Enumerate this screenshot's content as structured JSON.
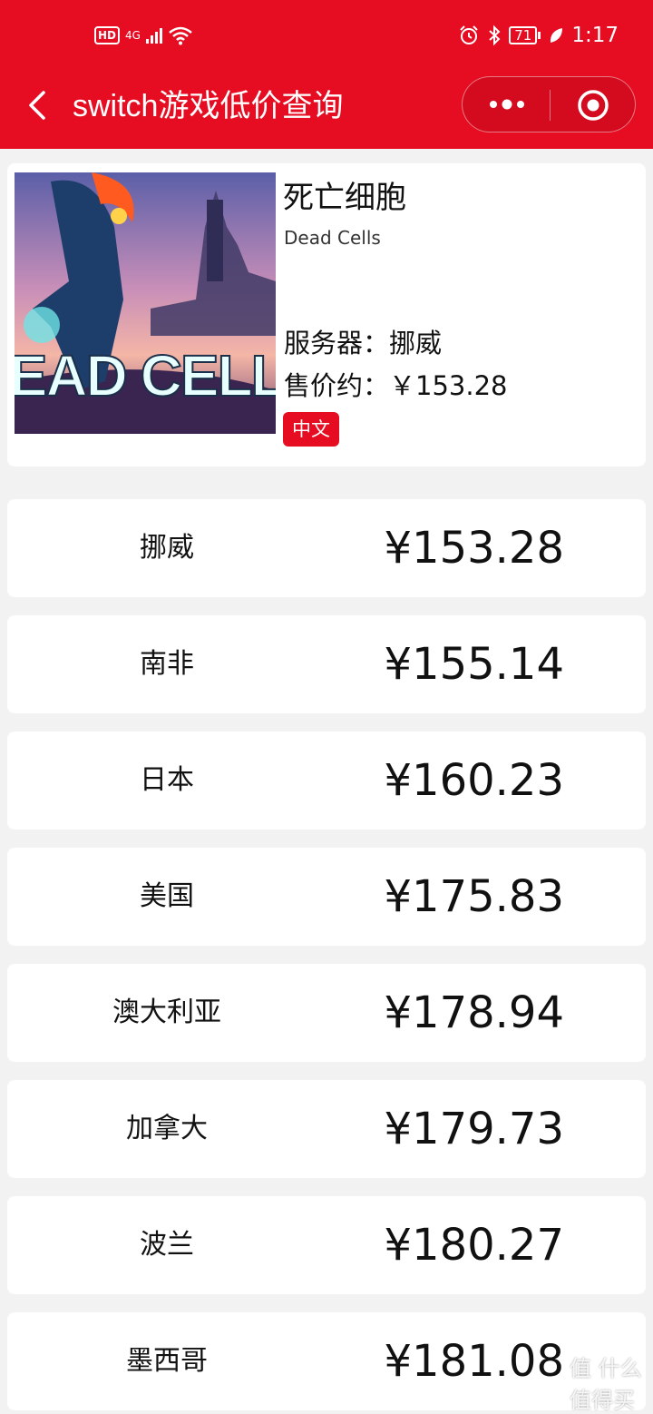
{
  "status_bar": {
    "hd": "HD",
    "network": "4G",
    "battery": "71",
    "time": "1:17"
  },
  "nav": {
    "title": "switch游戏低价查询"
  },
  "game": {
    "title": "死亡细胞",
    "subtitle": "Dead Cells",
    "cover_text": "DEAD CELLS",
    "server_label": "服务器：",
    "server_value": "挪威",
    "price_label": "售价约：",
    "price_value": "￥153.28",
    "tag": "中文"
  },
  "prices": [
    {
      "country": "挪威",
      "price": "¥153.28"
    },
    {
      "country": "南非",
      "price": "¥155.14"
    },
    {
      "country": "日本",
      "price": "¥160.23"
    },
    {
      "country": "美国",
      "price": "¥175.83"
    },
    {
      "country": "澳大利亚",
      "price": "¥178.94"
    },
    {
      "country": "加拿大",
      "price": "¥179.73"
    },
    {
      "country": "波兰",
      "price": "¥180.27"
    },
    {
      "country": "墨西哥",
      "price": "¥181.08"
    }
  ],
  "watermark": "值 什么值得买",
  "colors": {
    "brand": "#e60d22",
    "background": "#f2f2f2"
  }
}
